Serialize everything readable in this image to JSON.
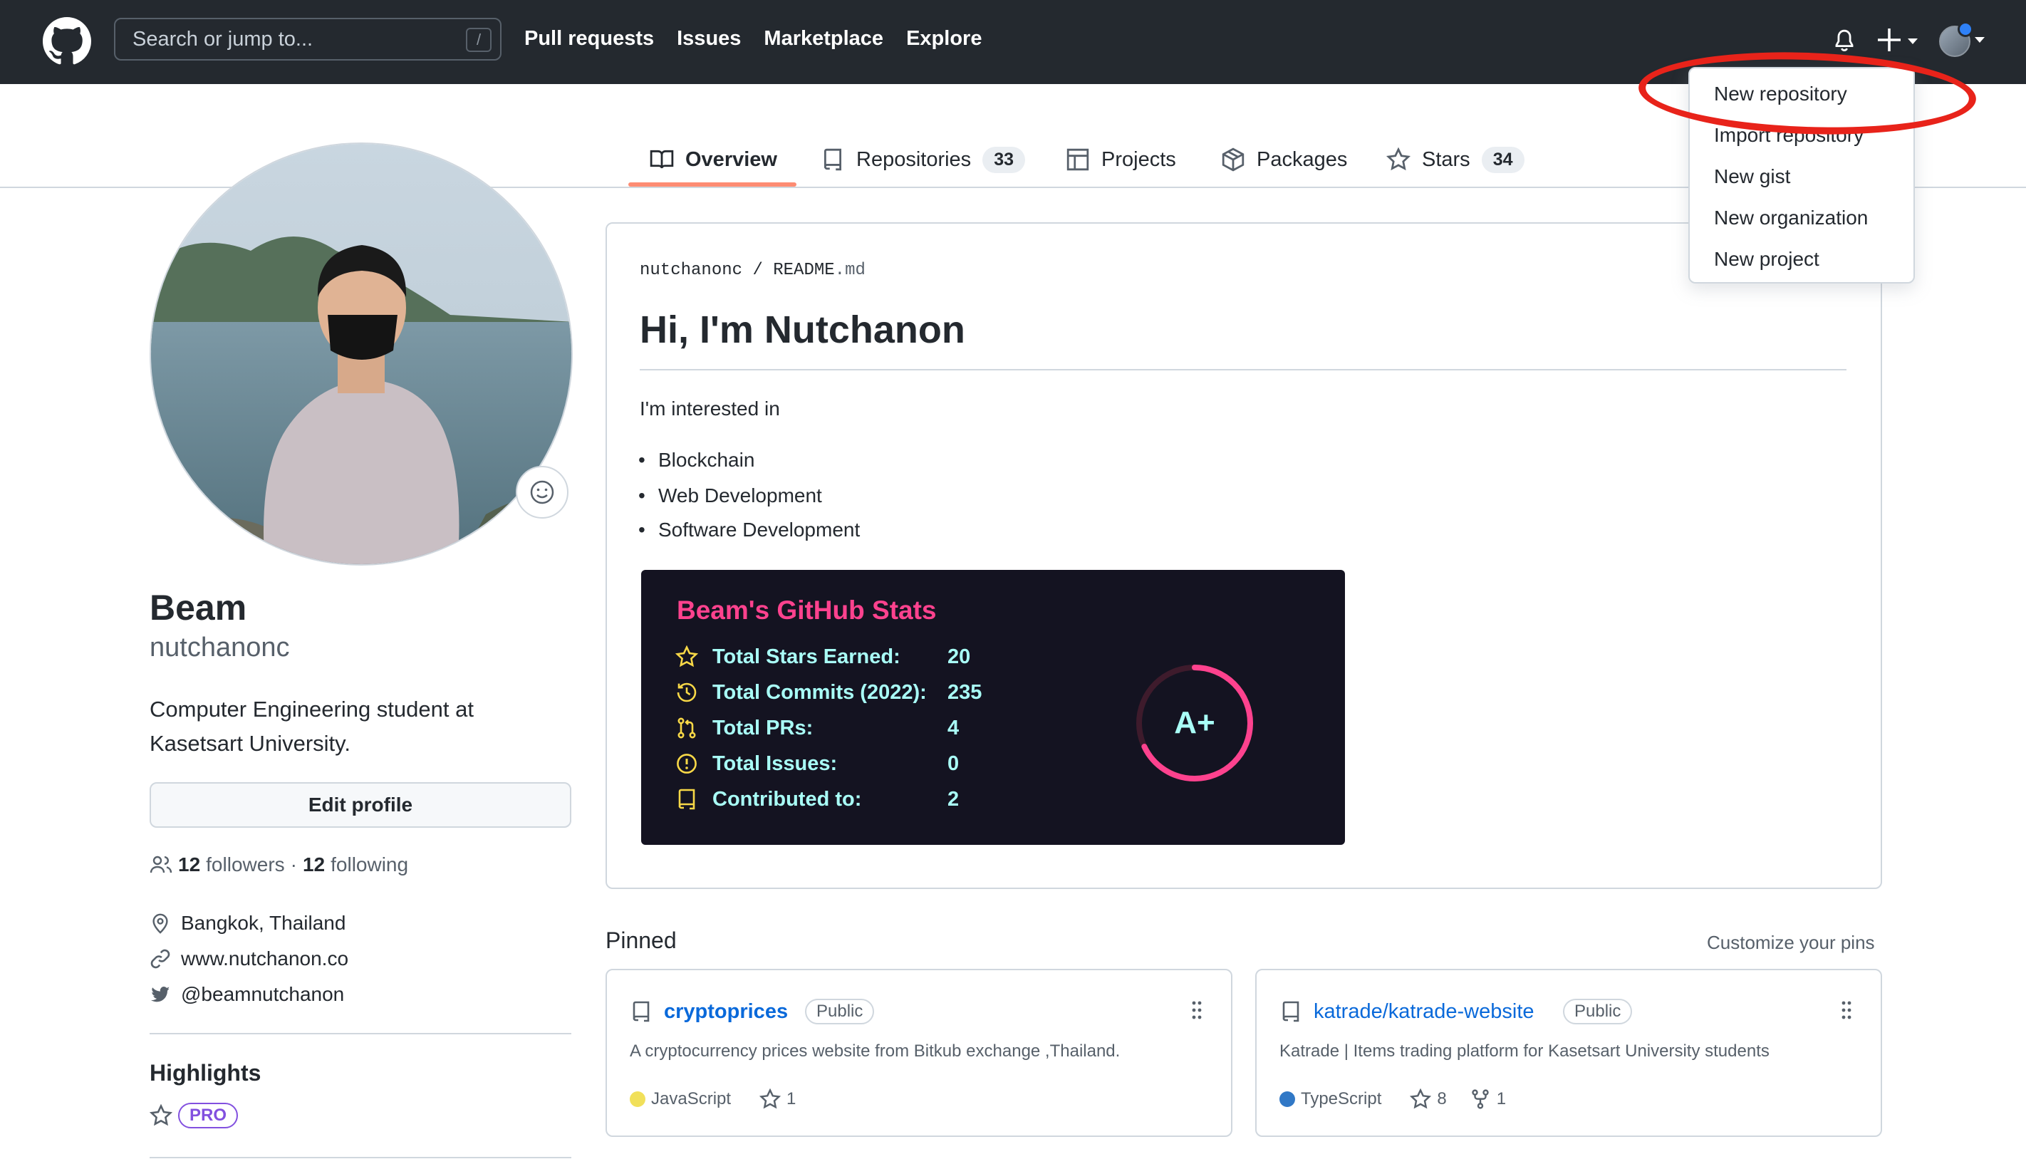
{
  "header": {
    "search_placeholder": "Search or jump to...",
    "search_shortcut": "/",
    "nav": [
      "Pull requests",
      "Issues",
      "Marketplace",
      "Explore"
    ]
  },
  "dropdown": {
    "items": [
      "New repository",
      "Import repository",
      "New gist",
      "New organization",
      "New project"
    ]
  },
  "tabs": [
    {
      "label": "Overview",
      "icon": "book-icon",
      "active": true
    },
    {
      "label": "Repositories",
      "icon": "repo-icon",
      "count": "33"
    },
    {
      "label": "Projects",
      "icon": "table-icon"
    },
    {
      "label": "Packages",
      "icon": "package-icon"
    },
    {
      "label": "Stars",
      "icon": "star-icon",
      "count": "34"
    }
  ],
  "profile": {
    "name": "Beam",
    "login": "nutchanonc",
    "bio": "Computer Engineering student at Kasetsart University.",
    "edit_label": "Edit profile",
    "followers_count": "12",
    "followers_label": "followers",
    "separator": "·",
    "following_count": "12",
    "following_label": "following",
    "location": "Bangkok, Thailand",
    "website": "www.nutchanon.co",
    "twitter": "@beamnutchanon",
    "highlights_title": "Highlights",
    "pro_label": "PRO"
  },
  "readme": {
    "path_user": "nutchanonc",
    "path_sep": "/",
    "path_file": "README",
    "path_ext": ".md",
    "heading": "Hi, I'm Nutchanon",
    "intro": "I'm interested in",
    "interests": [
      "Blockchain",
      "Web Development",
      "Software Development"
    ]
  },
  "stats": {
    "title": "Beam's GitHub Stats",
    "rows": [
      {
        "label": "Total Stars Earned:",
        "value": "20",
        "icon": "star-icon"
      },
      {
        "label": "Total Commits (2022):",
        "value": "235",
        "icon": "history-icon"
      },
      {
        "label": "Total PRs:",
        "value": "4",
        "icon": "pull-request-icon"
      },
      {
        "label": "Total Issues:",
        "value": "0",
        "icon": "issue-icon"
      },
      {
        "label": "Contributed to:",
        "value": "2",
        "icon": "repo-icon"
      }
    ],
    "rank": "A+",
    "rank_progress": 0.68,
    "colors": {
      "title": "#fe428e",
      "text": "#a9fef7",
      "icon": "#f8d847",
      "bg": "#141321",
      "ring": "#fe428e"
    }
  },
  "pinned": {
    "title": "Pinned",
    "customize": "Customize your pins",
    "repos": [
      {
        "name": "cryptoprices",
        "visibility": "Public",
        "description": "A cryptocurrency prices website from Bitkub exchange ,Thailand.",
        "language": "JavaScript",
        "language_color": "#f1e05a",
        "stars": "1"
      },
      {
        "name": "katrade/katrade-website",
        "visibility": "Public",
        "description": "Katrade | Items trading platform for Kasetsart University students",
        "language": "TypeScript",
        "language_color": "#3178c6",
        "stars": "8",
        "forks": "1"
      }
    ]
  }
}
